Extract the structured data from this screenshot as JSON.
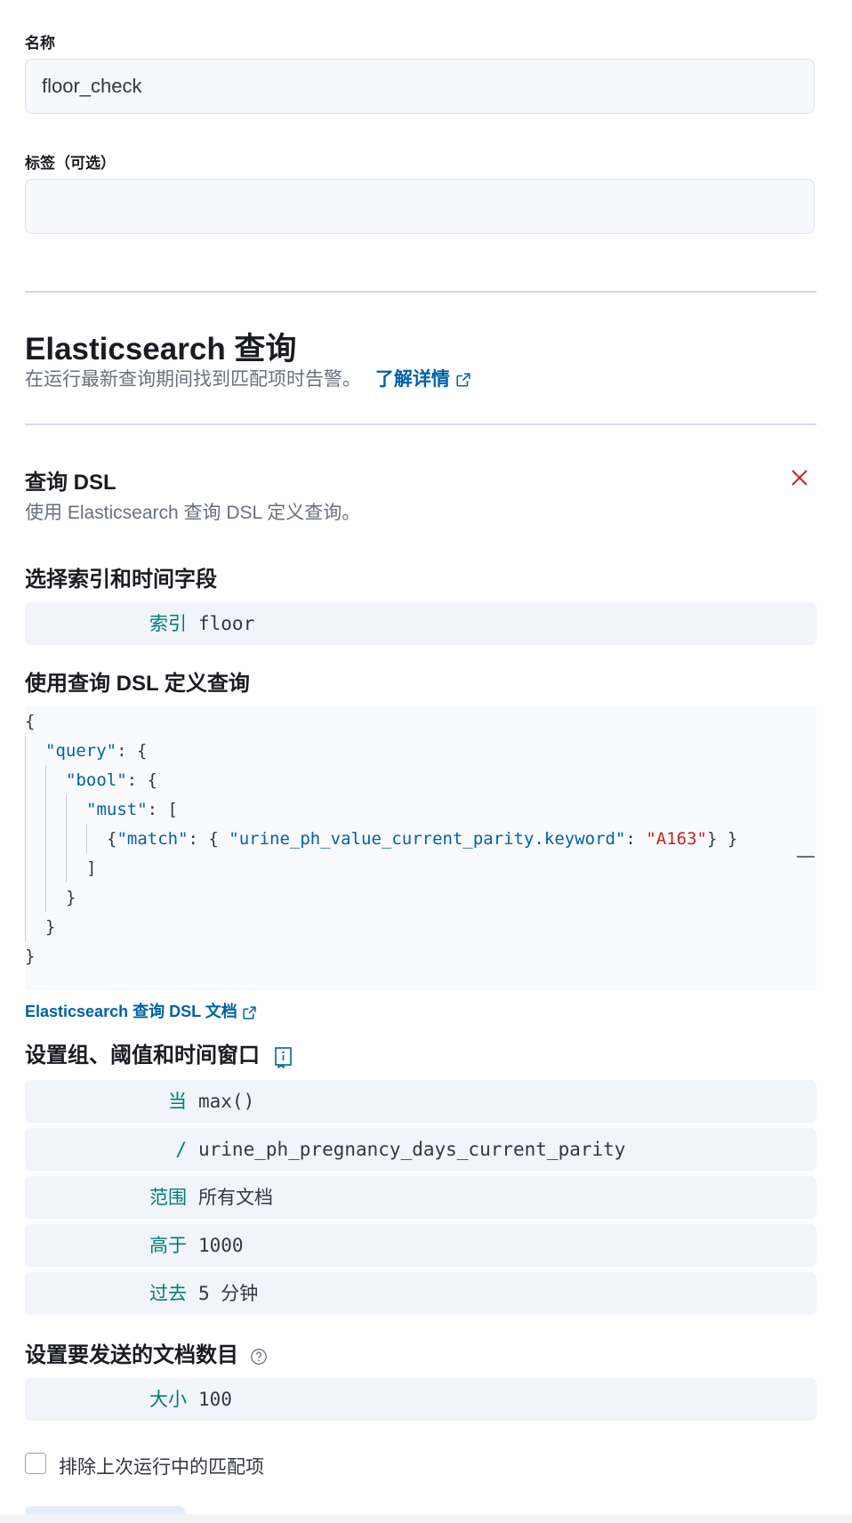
{
  "form": {
    "name_label": "名称",
    "name_value": "floor_check",
    "tags_label": "标签（可选）",
    "tags_value": ""
  },
  "rule_type": {
    "title": "Elasticsearch 查询",
    "description": "在运行最新查询期间找到匹配项时告警。",
    "learn_more": "了解详情"
  },
  "dsl_section": {
    "title": "查询 DSL",
    "description": "使用 Elasticsearch 查询 DSL 定义查询。"
  },
  "index_section": {
    "title": "选择索引和时间字段",
    "index_key": "索引",
    "index_value": "floor"
  },
  "query_section": {
    "title": "使用查询 DSL 定义查询",
    "code": {
      "l1": "{",
      "l2_key": "\"query\"",
      "l2_rest": ": {",
      "l3_key": "\"bool\"",
      "l3_rest": ": {",
      "l4_key": "\"must\"",
      "l4_rest": ": [",
      "l5_open": "{",
      "l5_key1": "\"match\"",
      "l5_mid": ": { ",
      "l5_key2": "\"urine_ph_value_current_parity.keyword\"",
      "l5_colon": ": ",
      "l5_str": "\"A163\"",
      "l5_close": "} }",
      "l6": "]",
      "l7": "}",
      "l8": "}",
      "l9": "}"
    },
    "docs_link": "Elasticsearch 查询 DSL 文档"
  },
  "threshold_section": {
    "title": "设置组、阈值和时间窗口",
    "rows": [
      {
        "key": "当",
        "value": "max()"
      },
      {
        "key": "/",
        "value": "urine_ph_pregnancy_days_current_parity"
      },
      {
        "key": "范围",
        "value": "所有文档"
      },
      {
        "key": "高于",
        "value": "1000"
      },
      {
        "key": "过去",
        "value": "5 分钟"
      }
    ]
  },
  "size_section": {
    "title": "设置要发送的文档数目",
    "key": "大小",
    "value": "100"
  },
  "exclude_checkbox": {
    "label": "排除上次运行中的匹配项",
    "checked": false
  },
  "colors": {
    "accent_link": "#0061a6",
    "expr_key": "#017d73",
    "string": "#bd271e",
    "danger": "#bd271e"
  }
}
